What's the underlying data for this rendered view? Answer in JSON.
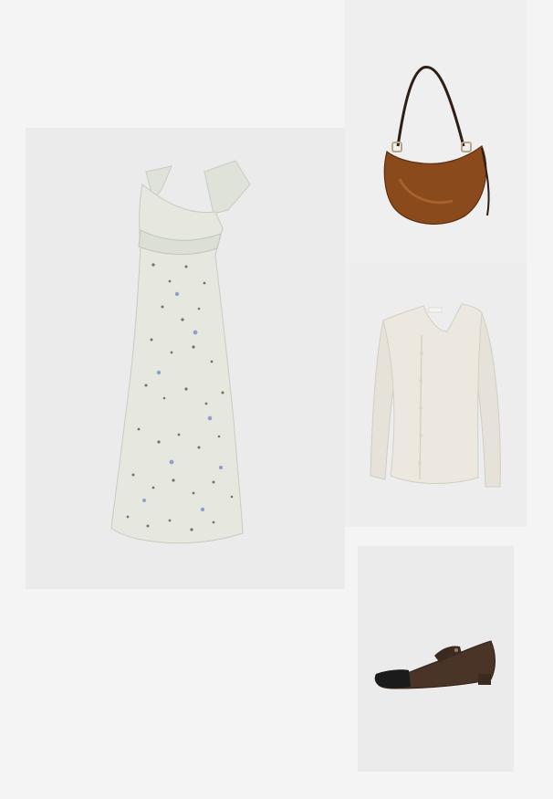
{
  "outfit": {
    "items": [
      {
        "name": "dress",
        "icon": "floral-dress-image",
        "background": "#ebebeb",
        "fabric": "#e6e8e0",
        "print_colors": [
          "#6d7a55",
          "#8f9fc8",
          "#a7b38a"
        ]
      },
      {
        "name": "bag",
        "icon": "crescent-bag-image",
        "background": "#efefef",
        "leather": "#8a4a1c",
        "strap": "#2e1f16"
      },
      {
        "name": "cardigan",
        "icon": "cardigan-image",
        "background": "#ededed",
        "knit": "#ece8e0"
      },
      {
        "name": "shoe",
        "icon": "mary-jane-shoe-image",
        "background": "#ebebeb",
        "suede": "#4a3428",
        "toe_cap": "#1b1b1b"
      }
    ]
  }
}
